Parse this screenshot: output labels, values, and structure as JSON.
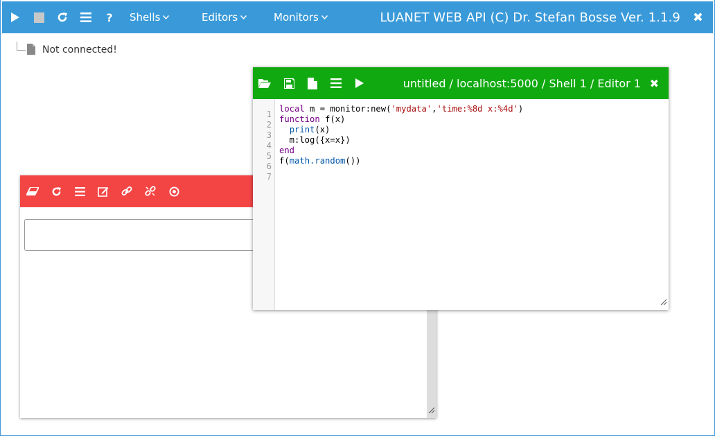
{
  "app": {
    "title": "LUANET WEB API (C) Dr. Stefan Bosse Ver. 1.1.9",
    "close_glyph": "✖",
    "accent": "#3a9ad9",
    "menus": [
      {
        "label": "Shells"
      },
      {
        "label": "Editors"
      },
      {
        "label": "Monitors"
      }
    ]
  },
  "status": {
    "text": "Not connected!"
  },
  "shell": {
    "accent": "#f44545",
    "input_value": ""
  },
  "editor": {
    "accent": "#10aa10",
    "title": "untitled / localhost:5000 / Shell 1 / Editor 1",
    "close_glyph": "✖",
    "line_numbers": [
      "1",
      "2",
      "3",
      "4",
      "5",
      "6",
      "7"
    ],
    "code_lines": [
      "local m = monitor:new('mydata','time:%8d x:%4d')",
      "function f(x)",
      "  print(x)",
      "  m:log({x=x})",
      "end",
      "f(math.random())",
      ""
    ]
  }
}
